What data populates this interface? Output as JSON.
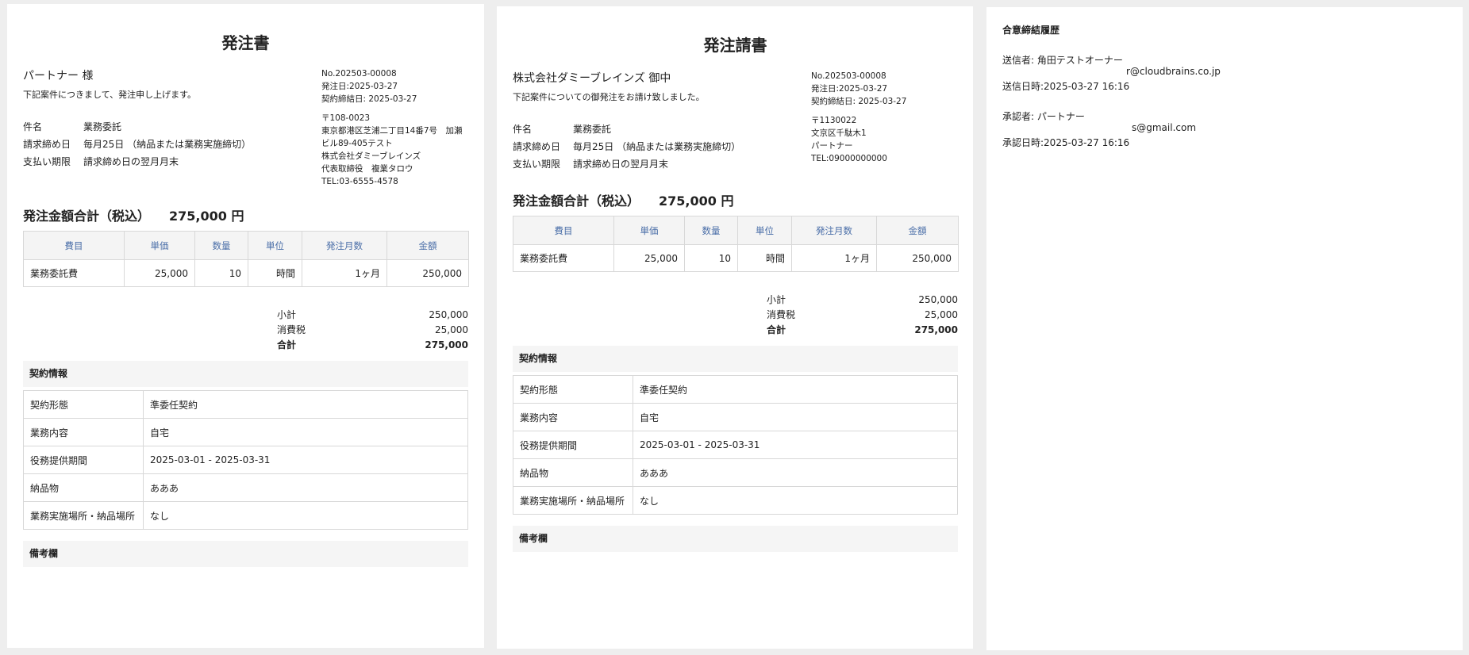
{
  "purchase_order": {
    "title": "発注書",
    "addressee": "パートナー 様",
    "lead": "下記案件につきまして、発注申し上げます。",
    "number": "No.202503-00008",
    "order_date": "発注日:2025-03-27",
    "contract_date": "契約締結日: 2025-03-27",
    "issuer": {
      "postal": "〒108-0023",
      "address": "東京都港区芝浦二丁目14番7号　加瀬ビル89-405テスト",
      "company": "株式会社ダミーブレインズ",
      "rep": "代表取締役　複業タロウ",
      "tel": "TEL:03-6555-4578"
    },
    "terms": [
      {
        "label": "件名",
        "value": "業務委託"
      },
      {
        "label": "請求締め日",
        "value": "毎月25日 （納品または業務実施締切）"
      },
      {
        "label": "支払い期限",
        "value": "請求締め日の翌月月末"
      }
    ],
    "total_label": "発注金額合計（税込）",
    "total_value": "275,000 円"
  },
  "order_acceptance": {
    "title": "発注請書",
    "addressee": "株式会社ダミーブレインズ 御中",
    "lead": "下記案件についての御発注をお請け致しました。",
    "number": "No.202503-00008",
    "order_date": "発注日:2025-03-27",
    "contract_date": "契約締結日: 2025-03-27",
    "partner": {
      "postal": "〒1130022",
      "address": "文京区千駄木1",
      "name": "パートナー",
      "tel": "TEL:09000000000"
    },
    "terms": [
      {
        "label": "件名",
        "value": "業務委託"
      },
      {
        "label": "請求締め日",
        "value": "毎月25日 （納品または業務実施締切）"
      },
      {
        "label": "支払い期限",
        "value": "請求締め日の翌月月末"
      }
    ],
    "total_label": "発注金額合計（税込）",
    "total_value": "275,000 円"
  },
  "items_table": {
    "headers": [
      "費目",
      "単価",
      "数量",
      "単位",
      "発注月数",
      "金額"
    ],
    "row": [
      "業務委託費",
      "25,000",
      "10",
      "時間",
      "1ヶ月",
      "250,000"
    ]
  },
  "sums": {
    "subtotal_label": "小計",
    "subtotal": "250,000",
    "tax_label": "消費税",
    "tax": "25,000",
    "total_label": "合計",
    "total": "275,000"
  },
  "contract": {
    "heading": "契約情報",
    "rows": [
      {
        "label": "契約形態",
        "value": "準委任契約"
      },
      {
        "label": "業務内容",
        "value": "自宅"
      },
      {
        "label": "役務提供期間",
        "value": "2025-03-01 - 2025-03-31"
      },
      {
        "label": "納品物",
        "value": "あああ"
      },
      {
        "label": "業務実施場所・納品場所",
        "value": "なし"
      }
    ]
  },
  "remarks_heading": "備考欄",
  "history": {
    "title": "合意締結履歴",
    "sender": "送信者: 角田テストオーナー",
    "sender_email": "r@cloudbrains.co.jp",
    "sent_at": "送信日時:2025-03-27 16:16",
    "approver": "承認者: パートナー",
    "approver_email": "s@gmail.com",
    "approved_at": "承認日時:2025-03-27 16:16"
  }
}
